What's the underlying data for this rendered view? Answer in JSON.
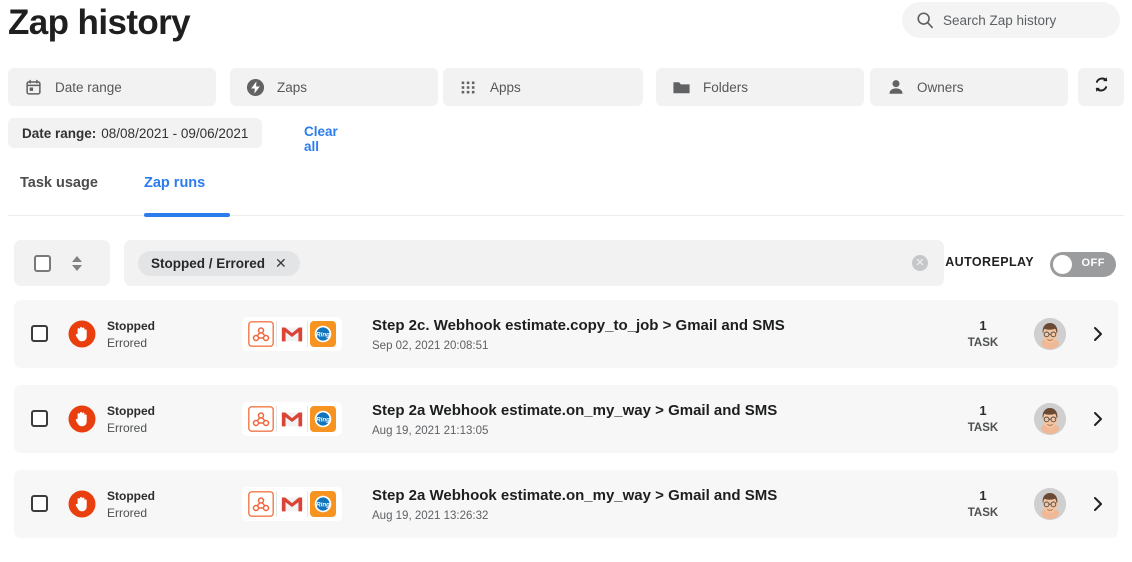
{
  "header": {
    "title": "Zap history",
    "search": {
      "placeholder": "Search Zap history",
      "value": "",
      "icon": "search-icon"
    }
  },
  "filters": {
    "buttons": [
      {
        "label": "Date range",
        "icon": "calendar-icon"
      },
      {
        "label": "Zaps",
        "icon": "zap-bolt-icon"
      },
      {
        "label": "Apps",
        "icon": "grid-apps-icon"
      },
      {
        "label": "Folders",
        "icon": "folder-icon"
      },
      {
        "label": "Owners",
        "icon": "person-icon"
      }
    ],
    "refresh_icon": "refresh-icon",
    "active_chip": {
      "label": "Date range:",
      "value": "08/08/2021 - 09/06/2021"
    },
    "clear_all": "Clear all"
  },
  "tabs": [
    {
      "label": "Task usage",
      "active": false
    },
    {
      "label": "Zap runs",
      "active": true
    }
  ],
  "toolbar": {
    "select_all_checkbox": "",
    "sort_icon": "sort-updown-icon",
    "status_filter_chip": {
      "label": "Stopped / Errored",
      "remove_icon": "close-icon"
    },
    "clear_field_icon": "clear-circle-icon",
    "autoreplay_label": "AUTOREPLAY",
    "autoreplay_state": "OFF"
  },
  "colors": {
    "accent_blue": "#2b7ced",
    "status_red": "#e93f0e",
    "row_bg": "#f7f7f7",
    "control_bg": "#f2f2f2"
  },
  "runs": [
    {
      "status_primary": "Stopped",
      "status_secondary": "Errored",
      "status_icon": "stop-hand-icon",
      "apps": [
        "webhook-icon",
        "gmail-icon",
        "ring-icon"
      ],
      "title": "Step 2c. Webhook estimate.copy_to_job > Gmail and SMS",
      "timestamp": "Sep 02, 2021 20:08:51",
      "task_count": "1",
      "task_label": "TASK",
      "avatar": "user-avatar",
      "chevron": "chevron-right-icon"
    },
    {
      "status_primary": "Stopped",
      "status_secondary": "Errored",
      "status_icon": "stop-hand-icon",
      "apps": [
        "webhook-icon",
        "gmail-icon",
        "ring-icon"
      ],
      "title": "Step 2a Webhook estimate.on_my_way > Gmail and SMS",
      "timestamp": "Aug 19, 2021 21:13:05",
      "task_count": "1",
      "task_label": "TASK",
      "avatar": "user-avatar",
      "chevron": "chevron-right-icon"
    },
    {
      "status_primary": "Stopped",
      "status_secondary": "Errored",
      "status_icon": "stop-hand-icon",
      "apps": [
        "webhook-icon",
        "gmail-icon",
        "ring-icon"
      ],
      "title": "Step 2a Webhook estimate.on_my_way > Gmail and SMS",
      "timestamp": "Aug 19, 2021 13:26:32",
      "task_count": "1",
      "task_label": "TASK",
      "avatar": "user-avatar",
      "chevron": "chevron-right-icon"
    }
  ]
}
